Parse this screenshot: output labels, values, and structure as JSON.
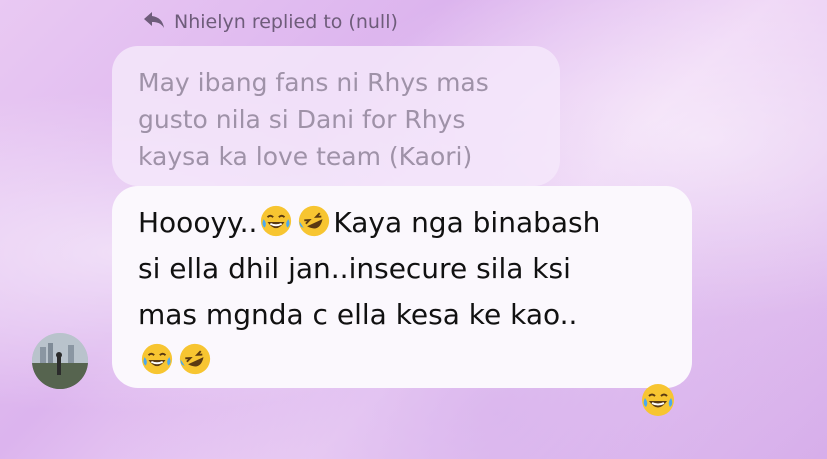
{
  "reply": {
    "header": "Nhielyn replied to (null)",
    "icon": "reply-arrow-icon"
  },
  "quoted": {
    "text_line1": "May ibang fans ni Rhys mas",
    "text_line2": "gusto nila si  Dani for Rhys",
    "text_line3": "kaysa ka love team (Kaori)"
  },
  "message": {
    "line1_prefix": "Hoooyy..",
    "line1_suffix": "Kaya nga binabash",
    "line2": "si ella dhil jan..insecure sila ksi",
    "line3": "mas mgnda c ella kesa ke kao.."
  },
  "avatar": {
    "icon": "avatar"
  },
  "reaction": {
    "icon": "tears-of-joy-emoji"
  },
  "colors": {
    "quoted_text": "#9f92a8",
    "message_text": "#111111",
    "bubble_bg": "#fbf8fd"
  }
}
